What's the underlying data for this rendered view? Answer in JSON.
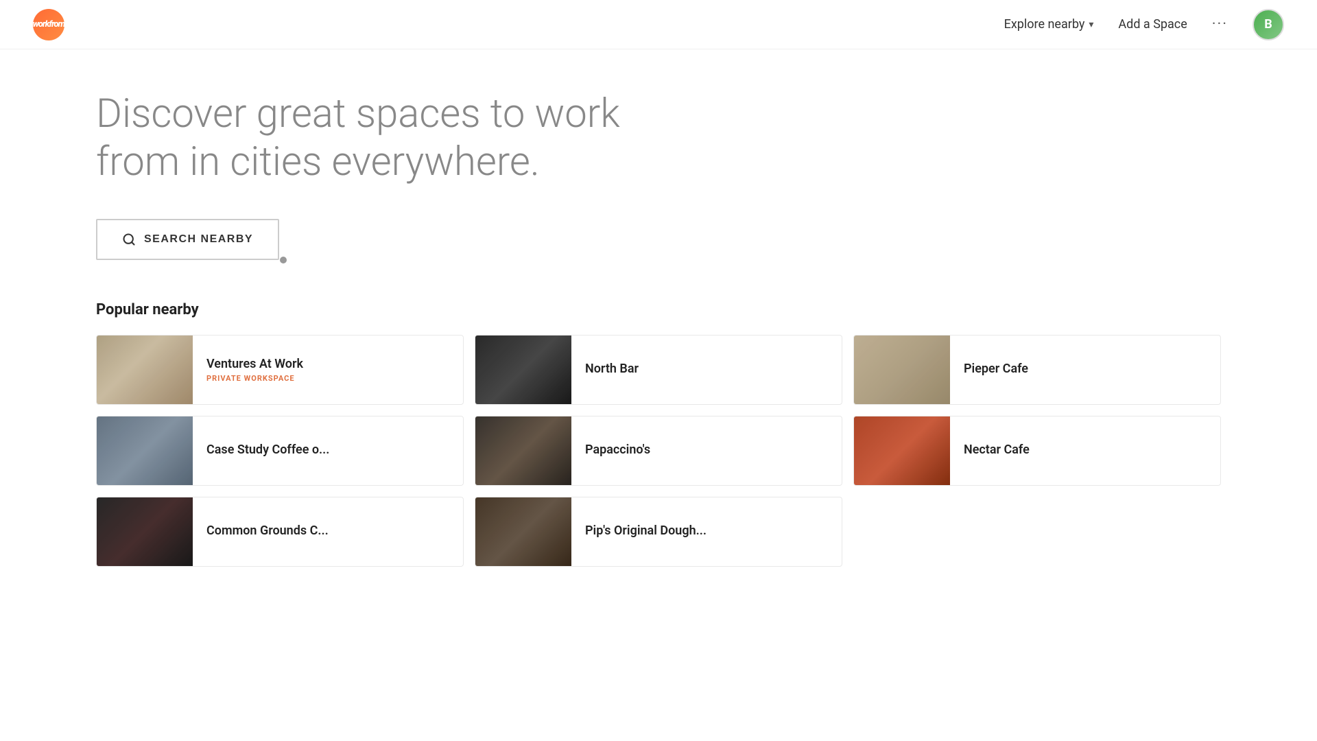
{
  "header": {
    "logo_text": "workfrom",
    "nav": {
      "explore_label": "Explore nearby",
      "add_space_label": "Add a Space",
      "dots": "···"
    },
    "user_avatar_label": "B"
  },
  "hero": {
    "title": "Discover great spaces to work from in cities everywhere.",
    "search_button_label": "SEARCH NEARBY"
  },
  "popular": {
    "section_title": "Popular nearby",
    "spaces": [
      {
        "name": "Ventures At Work",
        "tag": "PRIVATE WORKSPACE",
        "has_tag": true,
        "img_class": "img-ventures"
      },
      {
        "name": "North Bar",
        "tag": "",
        "has_tag": false,
        "img_class": "img-northbar"
      },
      {
        "name": "Pieper Cafe",
        "tag": "",
        "has_tag": false,
        "img_class": "img-pieper"
      },
      {
        "name": "Case Study Coffee o...",
        "tag": "",
        "has_tag": false,
        "img_class": "img-casestudy"
      },
      {
        "name": "Papaccino's",
        "tag": "",
        "has_tag": false,
        "img_class": "img-papaccino"
      },
      {
        "name": "Nectar Cafe",
        "tag": "",
        "has_tag": false,
        "img_class": "img-nectar"
      },
      {
        "name": "Common Grounds C...",
        "tag": "",
        "has_tag": false,
        "img_class": "img-common"
      },
      {
        "name": "Pip's Original Dough...",
        "tag": "",
        "has_tag": false,
        "img_class": "img-pips"
      }
    ]
  }
}
